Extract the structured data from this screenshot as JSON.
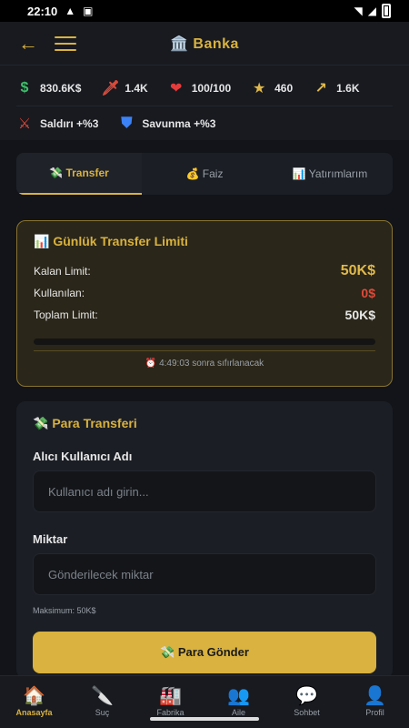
{
  "status_bar": {
    "time": "22:10"
  },
  "header": {
    "back_icon": "arrow-left-icon",
    "menu_icon": "hamburger-icon",
    "title": "🏛️ Banka"
  },
  "stats": {
    "money": "830.6K$",
    "power": "1.4K",
    "health": "100/100",
    "star": "460",
    "growth": "1.6K",
    "attack": "Saldırı +%3",
    "defense": "Savunma +%3"
  },
  "tabs": [
    {
      "label": "💸 Transfer"
    },
    {
      "label": "💰 Faiz"
    },
    {
      "label": "📊 Yatırımlarım"
    }
  ],
  "limit_card": {
    "title": "📊 Günlük Transfer Limiti",
    "rows": [
      {
        "label": "Kalan Limit:",
        "value": "50K$"
      },
      {
        "label": "Kullanılan:",
        "value": "0$"
      },
      {
        "label": "Toplam Limit:",
        "value": "50K$"
      }
    ],
    "progress_fraction": 0.0,
    "reset_text": "⏰ 4:49:03 sonra sıfırlanacak"
  },
  "transfer_card": {
    "title": "💸 Para Transferi",
    "recipient_label": "Alıcı Kullanıcı Adı",
    "recipient_placeholder": "Kullanıcı adı girin...",
    "amount_label": "Miktar",
    "amount_placeholder": "Gönderilecek miktar",
    "max_hint": "Maksimum: 50K$",
    "send_button": "💸 Para Gönder"
  },
  "nav": [
    {
      "label": "Anasayfa",
      "icon": "🏠"
    },
    {
      "label": "Suç",
      "icon": "🔪"
    },
    {
      "label": "Fabrika",
      "icon": "🏭"
    },
    {
      "label": "Aile",
      "icon": "👥"
    },
    {
      "label": "Sohbet",
      "icon": "💬"
    },
    {
      "label": "Profil",
      "icon": "👤"
    }
  ],
  "colors": {
    "accent": "#d9b23f",
    "danger": "#e04a3a",
    "background": "#121419"
  }
}
